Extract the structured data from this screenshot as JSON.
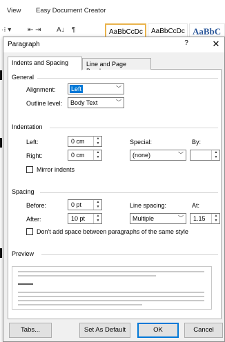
{
  "ribbon": {
    "tabs": [
      "View",
      "Easy Document Creator"
    ],
    "icons": [
      "bullets-icon",
      "indent-icon",
      "sort-icon",
      "pilcrow-icon"
    ],
    "styles": [
      "AaBbCcDc",
      "AaBbCcDc",
      "AaBbC"
    ]
  },
  "dialog": {
    "title": "Paragraph",
    "help": "?",
    "close": "✕",
    "tabs": [
      {
        "label": "Indents and Spacing",
        "selected": true
      },
      {
        "label": "Line and Page Breaks",
        "selected": false
      }
    ],
    "general": {
      "heading": "General",
      "alignment_label": "Alignment:",
      "alignment_value": "Left",
      "outline_label": "Outline level:",
      "outline_value": "Body Text"
    },
    "indentation": {
      "heading": "Indentation",
      "left_label": "Left:",
      "left_value": "0 cm",
      "right_label": "Right:",
      "right_value": "0 cm",
      "special_label": "Special:",
      "special_value": "(none)",
      "by_label": "By:",
      "by_value": "",
      "mirror_label": "Mirror indents",
      "mirror_checked": false
    },
    "spacing": {
      "heading": "Spacing",
      "before_label": "Before:",
      "before_value": "0 pt",
      "after_label": "After:",
      "after_value": "10 pt",
      "line_spacing_label": "Line spacing:",
      "line_spacing_value": "Multiple",
      "at_label": "At:",
      "at_value": "1.15",
      "dont_add_label": "Don't add space between paragraphs of the same style",
      "dont_add_checked": false
    },
    "preview": {
      "heading": "Preview"
    },
    "buttons": {
      "tabs": "Tabs...",
      "set_default": "Set As Default",
      "ok": "OK",
      "cancel": "Cancel"
    }
  }
}
